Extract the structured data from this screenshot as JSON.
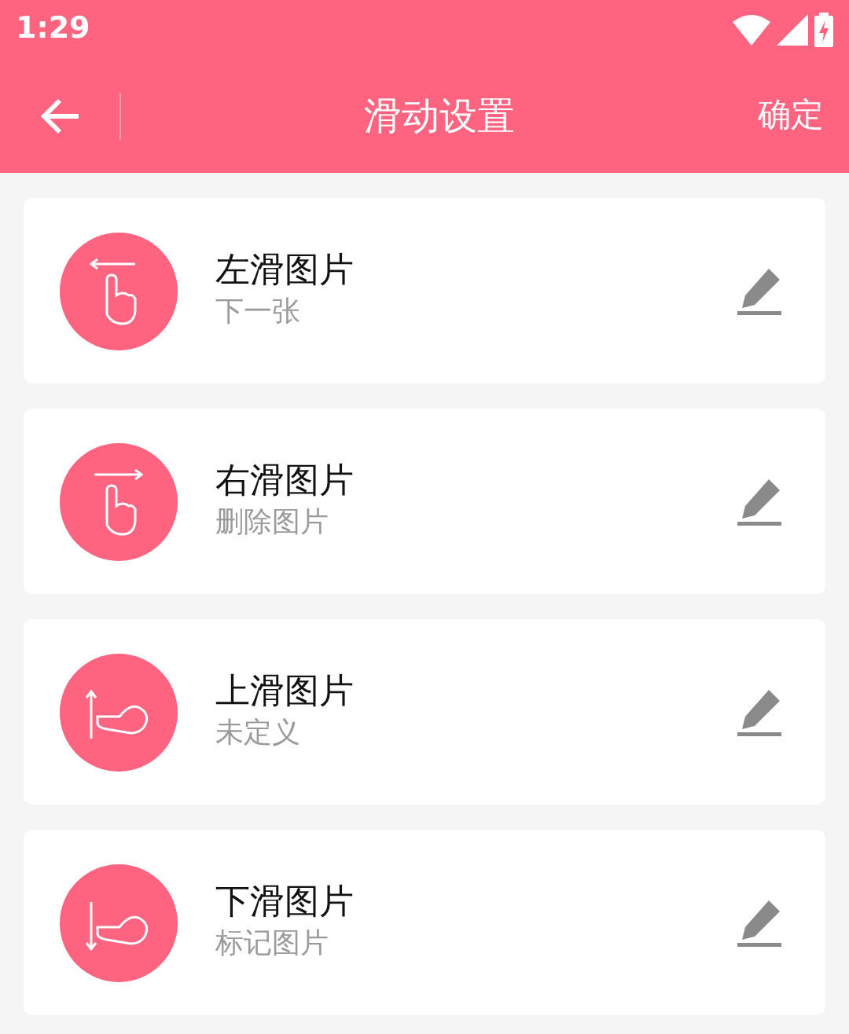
{
  "status_bar": {
    "time": "1:29"
  },
  "toolbar": {
    "title": "滑动设置",
    "action": "确定"
  },
  "gestures": [
    {
      "kind": "left",
      "title": "左滑图片",
      "action": "下一张"
    },
    {
      "kind": "right",
      "title": "右滑图片",
      "action": "删除图片"
    },
    {
      "kind": "up",
      "title": "上滑图片",
      "action": "未定义"
    },
    {
      "kind": "down",
      "title": "下滑图片",
      "action": "标记图片"
    }
  ]
}
